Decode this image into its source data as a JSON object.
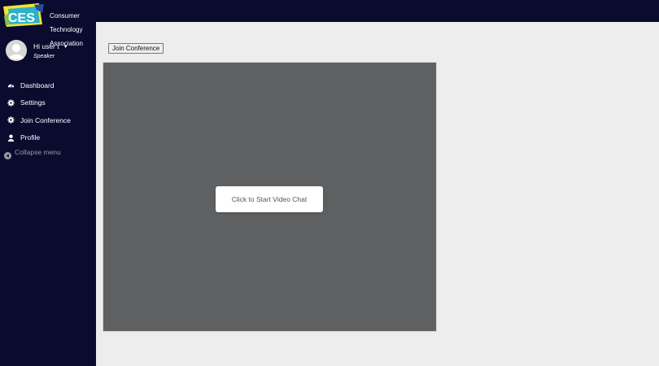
{
  "brand": {
    "logo_text": "CES",
    "org_lines": [
      "Consumer",
      "Technology",
      "Association"
    ]
  },
  "user": {
    "greeting": "Hi user t",
    "role": "Speaker"
  },
  "sidebar": {
    "items": [
      {
        "label": "Dashboard",
        "icon": "dashboard-icon"
      },
      {
        "label": "Settings",
        "icon": "gear-icon"
      },
      {
        "label": "Join Conference",
        "icon": "gear-icon"
      },
      {
        "label": "Profile",
        "icon": "user-icon"
      }
    ],
    "collapse_label": "Collapse menu"
  },
  "main": {
    "join_button_label": "Join Conference",
    "start_video_label": "Click to Start Video Chat"
  },
  "colors": {
    "sidebar_bg": "#0a0b2e",
    "content_bg": "#ededed",
    "video_bg": "#5f6062",
    "ces_yellow": "#f2e233",
    "ces_teal": "#2bb3c9"
  }
}
